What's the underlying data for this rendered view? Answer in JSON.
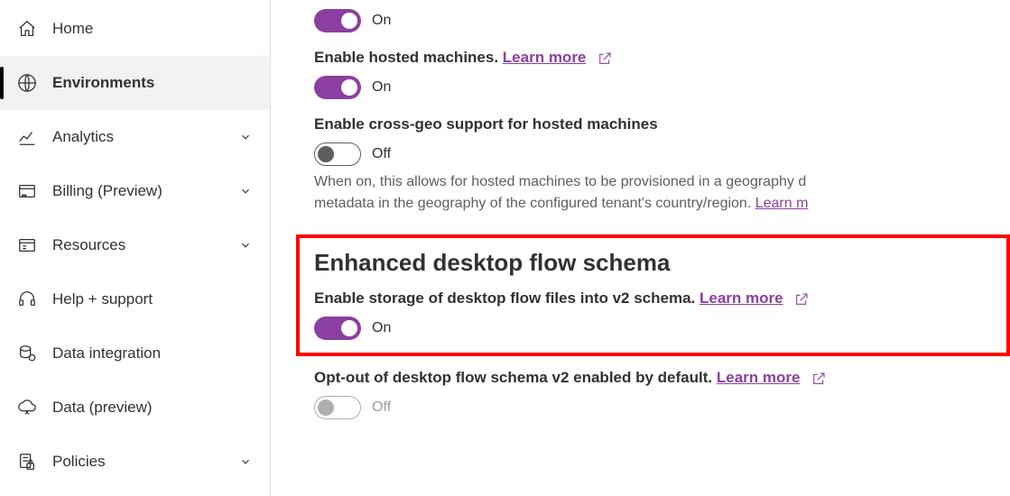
{
  "sidebar": {
    "items": [
      {
        "label": "Home"
      },
      {
        "label": "Environments"
      },
      {
        "label": "Analytics"
      },
      {
        "label": "Billing (Preview)"
      },
      {
        "label": "Resources"
      },
      {
        "label": "Help + support"
      },
      {
        "label": "Data integration"
      },
      {
        "label": "Data (preview)"
      },
      {
        "label": "Policies"
      }
    ]
  },
  "settings": {
    "s0": {
      "state": "On"
    },
    "s1": {
      "title": "Enable hosted machines.",
      "learn": "Learn more",
      "state": "On"
    },
    "s2": {
      "title": "Enable cross-geo support for hosted machines",
      "state": "Off",
      "desc_a": "When on, this allows for hosted machines to be provisioned in a geography d",
      "desc_b": "metadata in the geography of the configured tenant's country/region.",
      "learn": "Learn m"
    },
    "section": {
      "heading": "Enhanced desktop flow schema"
    },
    "s3": {
      "title": "Enable storage of desktop flow files into v2 schema.",
      "learn": "Learn more",
      "state": "On"
    },
    "s4": {
      "title": "Opt-out of desktop flow schema v2 enabled by default.",
      "learn": "Learn more",
      "state": "Off"
    }
  }
}
